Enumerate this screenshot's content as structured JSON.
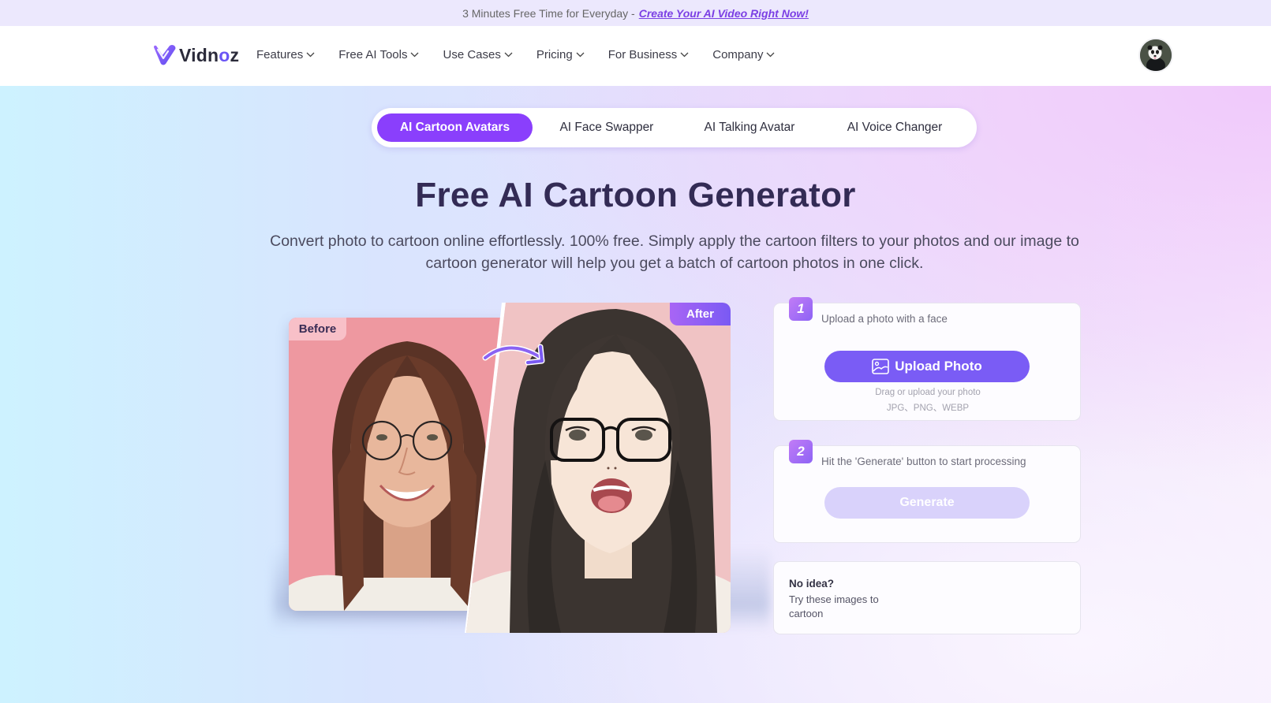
{
  "promo": {
    "lead": "3 Minutes Free Time for Everyday -",
    "link": "Create Your AI Video Right Now!"
  },
  "header": {
    "logo": {
      "text_before": "Vidn",
      "text_o": "o",
      "text_after": "z"
    },
    "nav": [
      {
        "label": "Features"
      },
      {
        "label": "Free AI Tools"
      },
      {
        "label": "Use Cases"
      },
      {
        "label": "Pricing"
      },
      {
        "label": "For Business"
      },
      {
        "label": "Company"
      }
    ],
    "avatar_icon": "panda-avatar"
  },
  "hero": {
    "tabs": [
      {
        "label": "AI Cartoon Avatars",
        "active": true
      },
      {
        "label": "AI Face Swapper",
        "active": false
      },
      {
        "label": "AI Talking Avatar",
        "active": false
      },
      {
        "label": "AI Voice Changer",
        "active": false
      }
    ],
    "title": "Free AI Cartoon Generator",
    "subtitle": "Convert photo to cartoon online effortlessly. 100% free. Simply apply the cartoon filters to your photos and our image to cartoon generator will help you get a batch of cartoon photos in one click.",
    "showcase": {
      "before_label": "Before",
      "after_label": "After"
    }
  },
  "steps": {
    "step1": {
      "number": "1",
      "description": "Upload a photo with a face",
      "button": "Upload Photo",
      "hint": "Drag or upload your photo",
      "formats": "JPG、PNG、WEBP"
    },
    "step2": {
      "number": "2",
      "description": "Hit the 'Generate' button to start processing",
      "button": "Generate"
    },
    "idea": {
      "title": "No idea?",
      "text": "Try these images to cartoon"
    }
  },
  "colors": {
    "accent": "#8a3ffc",
    "upload_button": "#7a5cf5",
    "generate_disabled": "#d9d2fb",
    "title": "#332b55",
    "promo_link": "#7b3fe4"
  }
}
